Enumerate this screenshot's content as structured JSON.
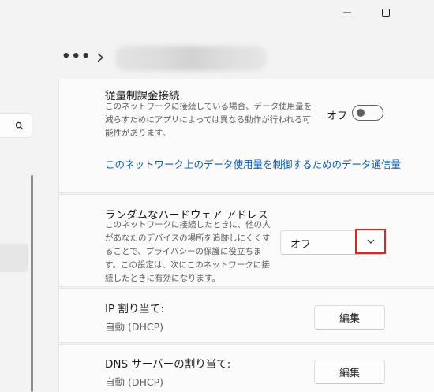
{
  "window": {
    "minimize_label": "Minimize",
    "maximize_label": "Maximize"
  },
  "header": {
    "more_label": "•••"
  },
  "metered": {
    "label": "従量制課金接続",
    "description": "このネットワークに接続している場合、データ使用量を\n減らすためにアプリによっては異なる動作が行われる可\n能性があります。",
    "toggle_state": "オフ",
    "link_text": "このネットワーク上のデータ使用量を制御するためのデータ通信量"
  },
  "random_hw": {
    "label": "ランダムなハードウェア アドレス",
    "description": "このネットワークに接続したときに、他の人\nがあなたのデバイスの場所を追跡しにくくす\nることで、プライバシーの保護に役立ちま\nす。この設定は、次にこのネットワークに接\n続したときに有効になります。",
    "selected_value": "オフ"
  },
  "ip": {
    "label": "IP 割り当て:",
    "value": "自動 (DHCP)",
    "edit_label": "編集"
  },
  "dns": {
    "label": "DNS サーバーの割り当て:",
    "value": "自動 (DHCP)",
    "edit_label": "編集"
  },
  "colors": {
    "accent_link": "#0b5cad",
    "highlight_border": "#d9262c"
  }
}
